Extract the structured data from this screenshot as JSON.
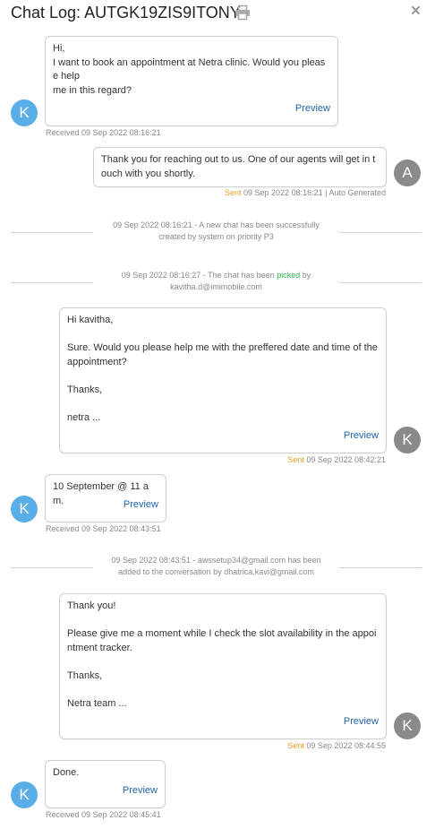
{
  "header": {
    "title": "Chat Log: AUTGK19ZIS9ITONY",
    "print_icon": "printer-icon",
    "close_icon": "×"
  },
  "avatars": {
    "customer": "K",
    "auto": "A",
    "agent": "K"
  },
  "messages": [
    {
      "text": "Hi,\nI want to book an appointment at Netra clinic. Would you please help\nme in this regard?",
      "preview": "Preview",
      "meta_status": "Received",
      "meta_time": "09 Sep 2022 08:16:21"
    },
    {
      "text": "Thank you for reaching out to us. One of our agents will get in touch with you shortly.",
      "meta_status": "Sent",
      "meta_time": "09 Sep 2022 08:16:21 | Auto Generated"
    },
    {
      "text": "Hi kavitha,\n\nSure. Would you please help me with the preffered date and time of the appointment?\n\nThanks,\n\nnetra ...",
      "preview": "Preview",
      "meta_status": "Sent",
      "meta_time": "09 Sep 2022 08:42:21"
    },
    {
      "text": "10 September @ 11 am.",
      "preview": "Preview",
      "meta_status": "Received",
      "meta_time": "09 Sep 2022 08:43:51"
    },
    {
      "text": "Thank you!\n\nPlease give me a moment while I check the slot availability in the appointment tracker.\n\nThanks,\n\nNetra team ...",
      "preview": "Preview",
      "meta_status": "Sent",
      "meta_time": "09 Sep 2022 08:44:55"
    },
    {
      "text": "Done.",
      "preview": "Preview",
      "meta_status": "Received",
      "meta_time": "09 Sep 2022 08:45:41"
    }
  ],
  "system_events": [
    {
      "line1": "09 Sep 2022 08:16:21 - A new chat has been successfully",
      "line2": "created by system on priority P3"
    },
    {
      "line1_pre": "09 Sep 2022 08:16:27 - The chat has been ",
      "line1_picked": "picked",
      "line1_post": " by",
      "line2": "kavitha.d@imimobile.com"
    },
    {
      "line1": "09 Sep 2022 08:43:51 - awssetup34@gmail.com has been",
      "line2": "added to the conversation by dhatrica.kavi@gmail.com"
    }
  ],
  "colors": {
    "customer_avatar": "#5aaee8",
    "agent_avatar": "#8a8a8a",
    "preview_link": "#1e64a8",
    "sent_label": "#e8a020",
    "picked_label": "#2bb24c"
  }
}
